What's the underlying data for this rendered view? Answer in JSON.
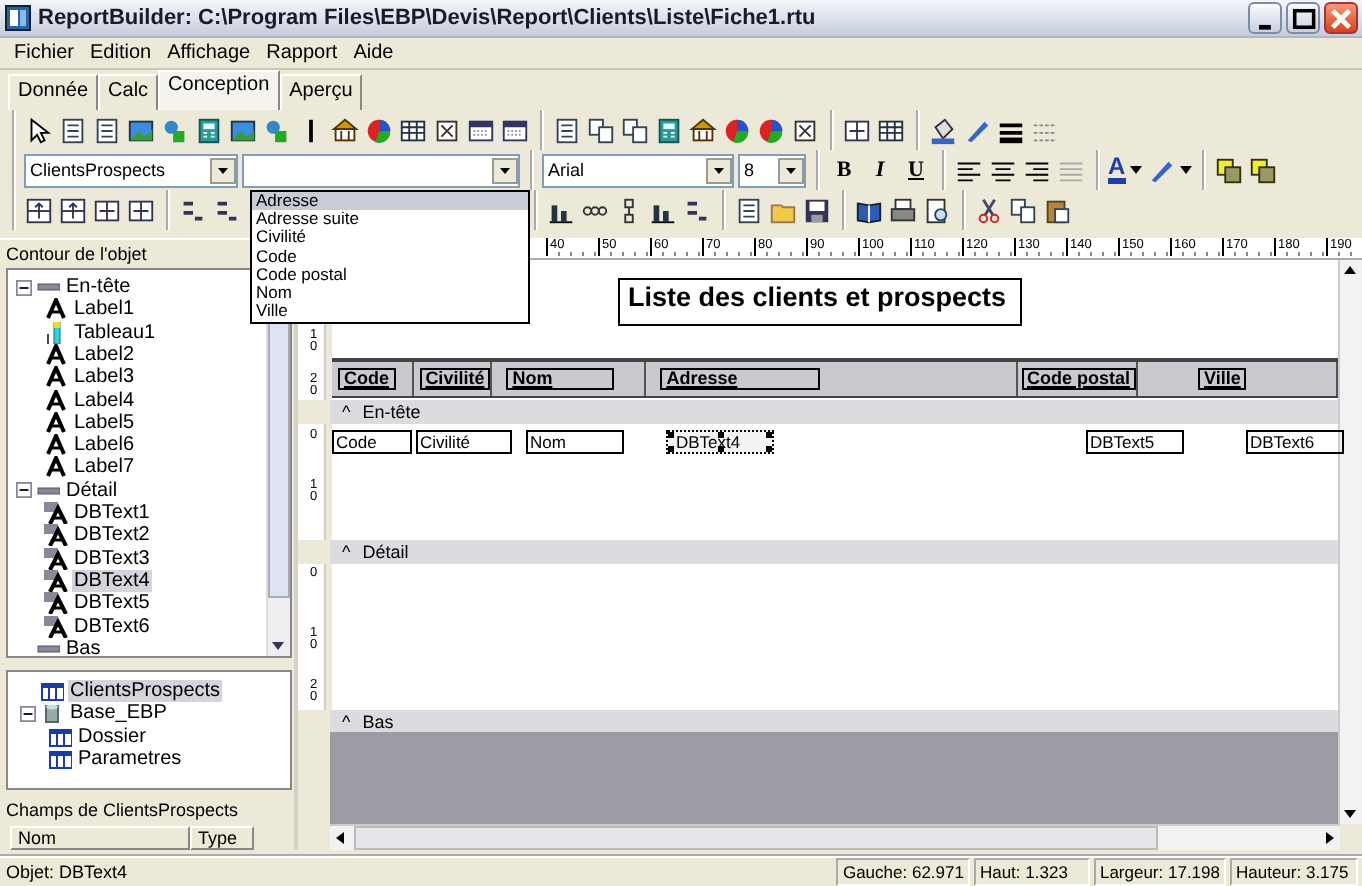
{
  "window": {
    "title": "ReportBuilder: C:\\Program Files\\EBP\\Devis\\Report\\Clients\\Liste\\Fiche1.rtu"
  },
  "menu": [
    "Fichier",
    "Edition",
    "Affichage",
    "Rapport",
    "Aide"
  ],
  "tabs": [
    {
      "label": "Donnée",
      "selected": false
    },
    {
      "label": "Calc",
      "selected": false
    },
    {
      "label": "Conception",
      "selected": true
    },
    {
      "label": "Aperçu",
      "selected": false
    }
  ],
  "toolbar": {
    "data_source": "ClientsProspects",
    "field_dropdown": {
      "expanded": true,
      "options": [
        {
          "label": "Adresse",
          "selected": true
        },
        {
          "label": "Adresse suite",
          "selected": false
        },
        {
          "label": "Civilité",
          "selected": false
        },
        {
          "label": "Code",
          "selected": false
        },
        {
          "label": "Code postal",
          "selected": false
        },
        {
          "label": "Nom",
          "selected": false
        },
        {
          "label": "Ville",
          "selected": false
        }
      ]
    },
    "font": "Arial",
    "font_size": "8",
    "style_buttons": [
      "B",
      "I",
      "U"
    ],
    "font_color_button": "A"
  },
  "outline": {
    "title": "Contour de l'objet",
    "items": [
      {
        "label": "En-tête",
        "kind": "band",
        "expanded": true,
        "children": [
          {
            "label": "Label1",
            "kind": "label",
            "selected": false
          },
          {
            "label": "Tableau1",
            "kind": "table",
            "selected": false
          },
          {
            "label": "Label2",
            "kind": "label",
            "selected": false
          },
          {
            "label": "Label3",
            "kind": "label",
            "selected": false
          },
          {
            "label": "Label4",
            "kind": "label",
            "selected": false
          },
          {
            "label": "Label5",
            "kind": "label",
            "selected": false
          },
          {
            "label": "Label6",
            "kind": "label",
            "selected": false
          },
          {
            "label": "Label7",
            "kind": "label",
            "selected": false
          }
        ]
      },
      {
        "label": "Détail",
        "kind": "band",
        "expanded": true,
        "children": [
          {
            "label": "DBText1",
            "kind": "dbtext",
            "selected": false
          },
          {
            "label": "DBText2",
            "kind": "dbtext",
            "selected": false
          },
          {
            "label": "DBText3",
            "kind": "dbtext",
            "selected": false
          },
          {
            "label": "DBText4",
            "kind": "dbtext",
            "selected": true
          },
          {
            "label": "DBText5",
            "kind": "dbtext",
            "selected": false
          },
          {
            "label": "DBText6",
            "kind": "dbtext",
            "selected": false
          }
        ]
      },
      {
        "label": "Bas",
        "kind": "band"
      }
    ]
  },
  "data_tree": [
    {
      "label": "ClientsProspects",
      "kind": "table",
      "selected": true
    },
    {
      "label": "Base_EBP",
      "kind": "database",
      "expanded": true,
      "selected": false,
      "children": [
        {
          "label": "Dossier",
          "kind": "table",
          "selected": false
        },
        {
          "label": "Parametres",
          "kind": "table",
          "selected": false
        }
      ]
    }
  ],
  "fields_panel": {
    "title": "Champs de ClientsProspects",
    "columns": [
      "Nom",
      "Type"
    ]
  },
  "ruler_labels": [
    "40",
    "50",
    "60",
    "70",
    "80",
    "90",
    "100",
    "110",
    "120",
    "130",
    "140",
    "150",
    "160",
    "170",
    "180",
    "190"
  ],
  "report": {
    "title": "Liste des clients et prospects",
    "column_headers": [
      "Code",
      "Civilité",
      "Nom",
      "Adresse",
      "Code postal",
      "Ville"
    ],
    "bands": [
      {
        "marker": "^",
        "label": "En-tête",
        "ruler": [
          "10",
          "20"
        ]
      },
      {
        "marker": "^",
        "label": "Détail",
        "ruler": [
          "0",
          "10"
        ]
      },
      {
        "marker": "^",
        "label": "Bas",
        "ruler": [
          "0",
          "10",
          "20"
        ]
      }
    ],
    "fields": [
      {
        "text": "Code",
        "selected": false
      },
      {
        "text": "Civilité",
        "selected": false
      },
      {
        "text": "Nom",
        "selected": false
      },
      {
        "text": "DBText4",
        "selected": true
      },
      {
        "text": "DBText5",
        "selected": false
      },
      {
        "text": "DBText6",
        "selected": false
      }
    ]
  },
  "status_bar": {
    "object": "Objet: DBText4",
    "panels": [
      "Gauche: 62.971",
      "Haut: 1.323",
      "Largeur: 17.198",
      "Hauteur: 3.175"
    ]
  }
}
